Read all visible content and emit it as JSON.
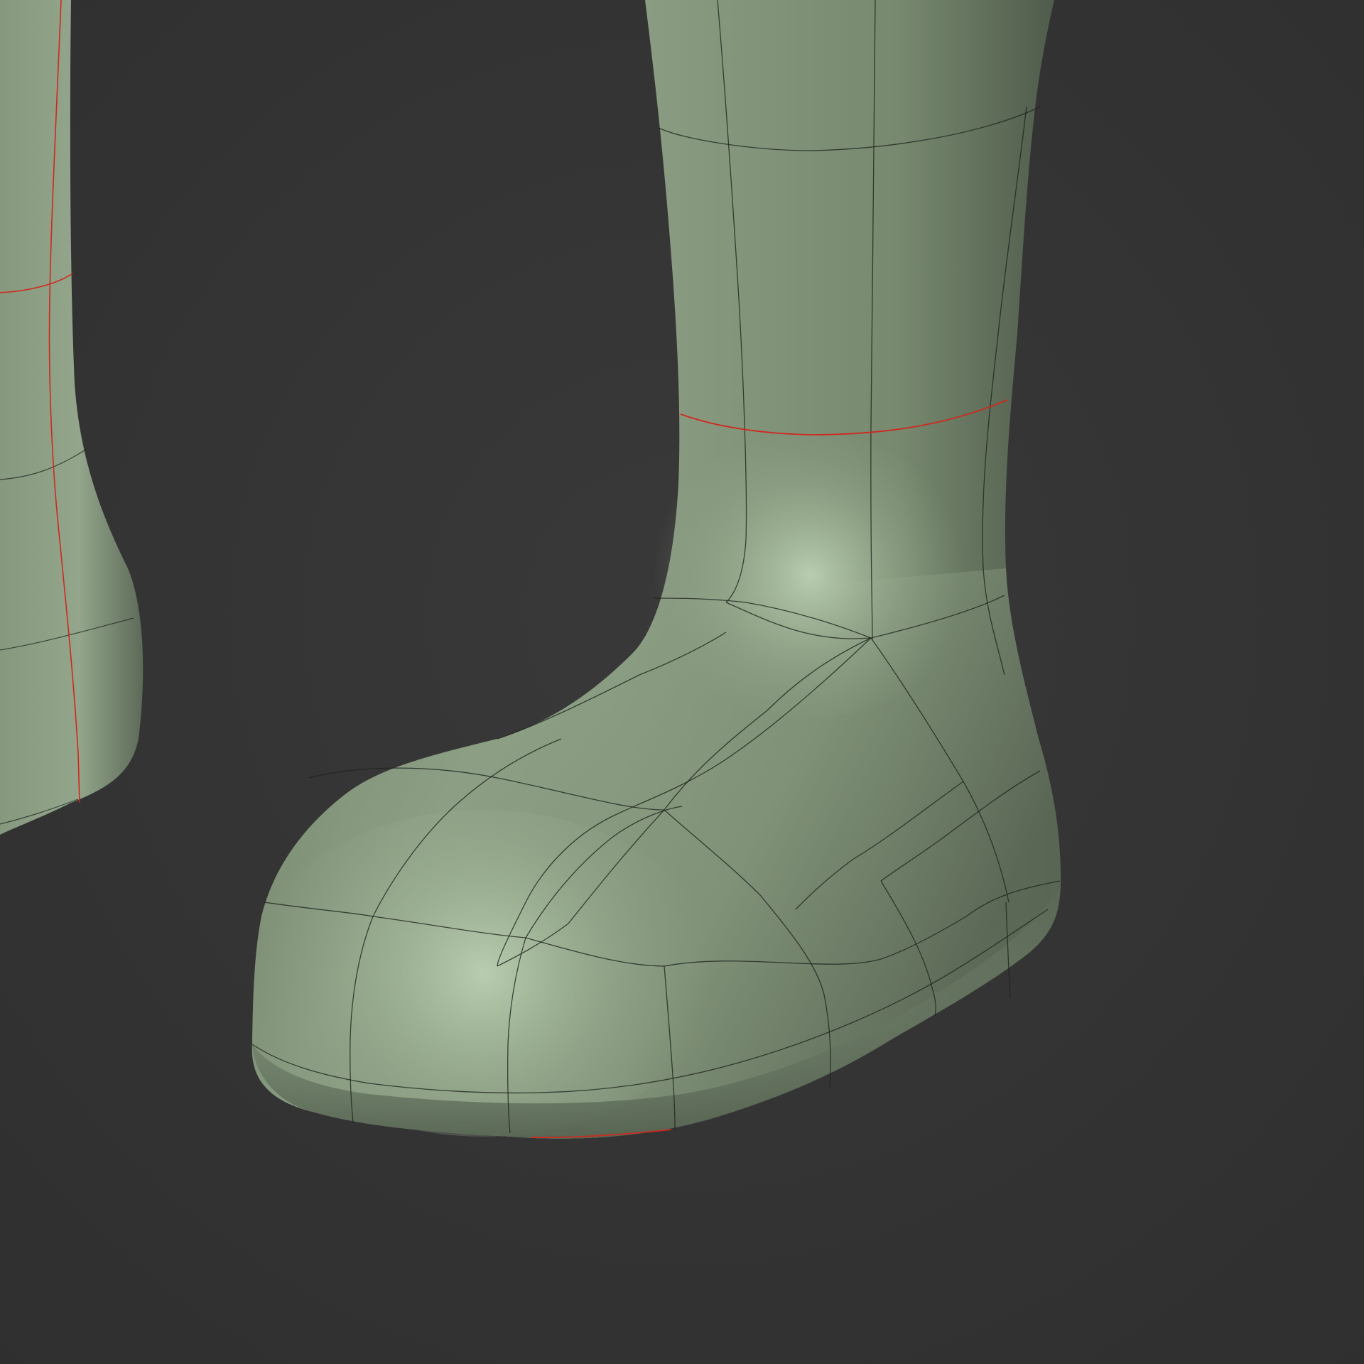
{
  "viewport": {
    "background_color": "#333333",
    "vignette_color": "#393939"
  },
  "model": {
    "name": "boot-mesh",
    "base_color": "#8fa287",
    "highlight_color": "#b8ccb0",
    "shadow_color": "#4f5a4c",
    "wire_color": "#1f241e",
    "seam_color": "#d0281e"
  },
  "icons": {
    "seam": "uv-seam-edge",
    "wire": "mesh-wireframe-edge"
  }
}
